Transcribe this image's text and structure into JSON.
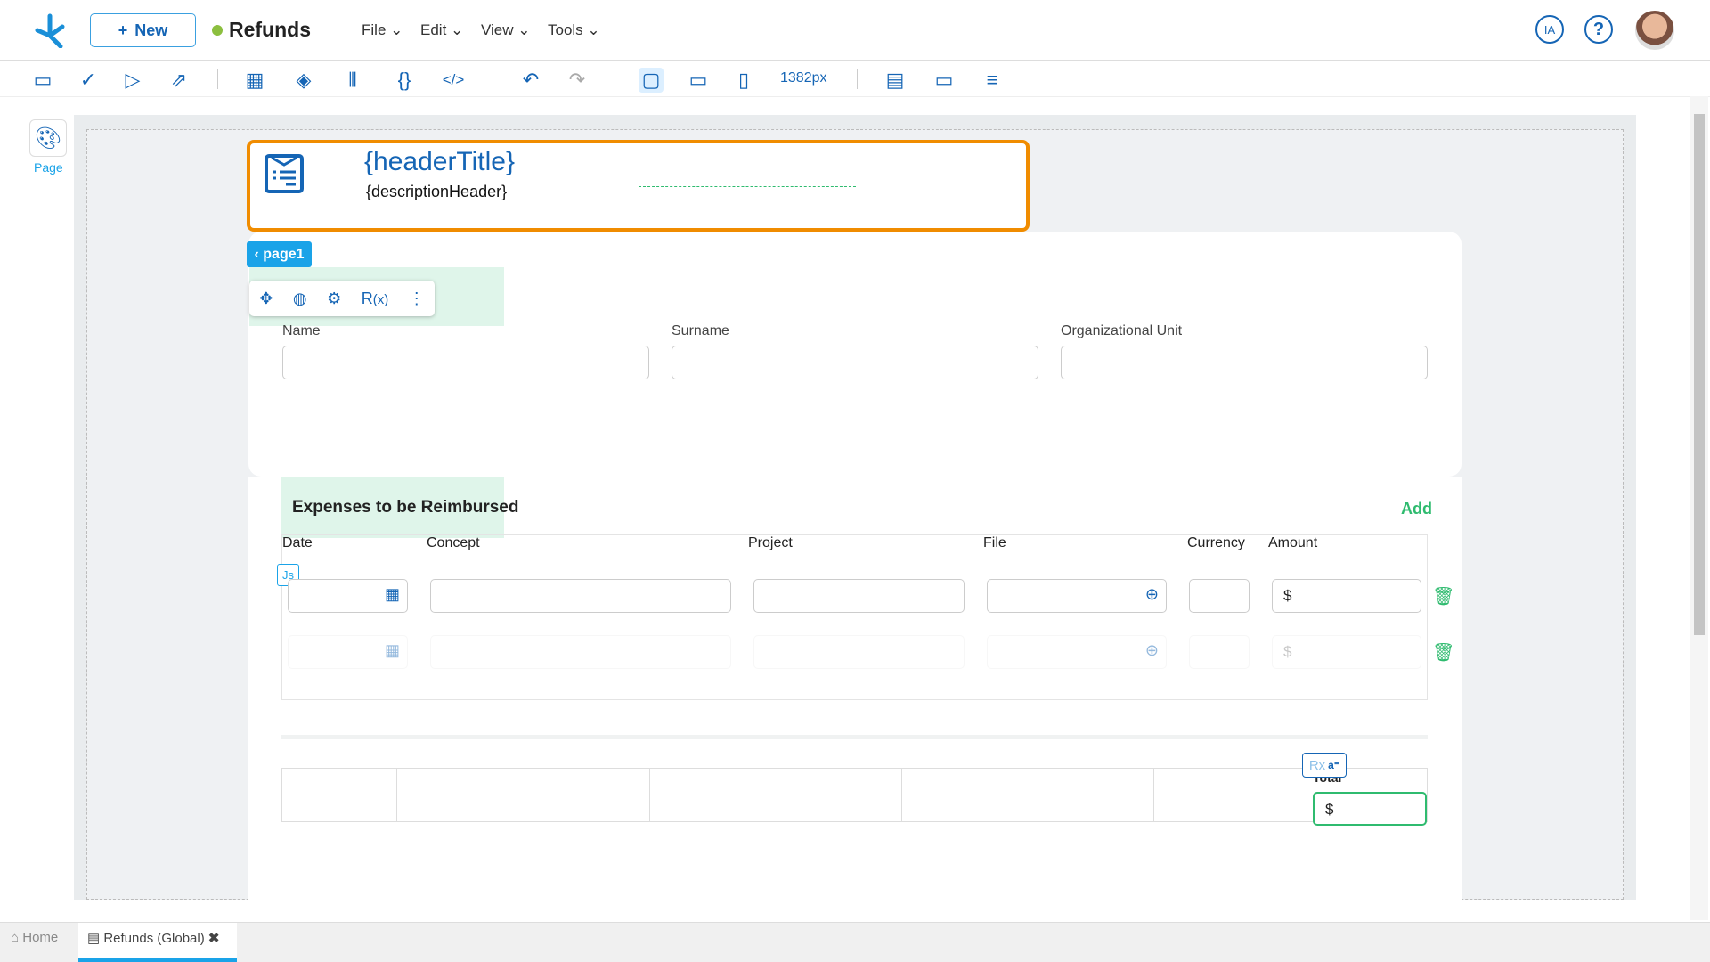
{
  "header": {
    "new_label": "New",
    "app_title": "Refunds",
    "status_color": "#8cbf3f",
    "menus": [
      "File",
      "Edit",
      "View",
      "Tools"
    ],
    "ia_label": "IA"
  },
  "toolbar": {
    "width_label": "1382px",
    "icons": [
      "save-icon",
      "check-icon",
      "play-icon",
      "export-icon",
      "components-icon",
      "layers-icon",
      "data-icon",
      "braces-icon",
      "code-icon",
      "undo-icon",
      "redo-icon",
      "desktop-icon",
      "tablet-icon",
      "mobile-icon",
      "layout-icon",
      "frame-icon",
      "align-icon"
    ]
  },
  "sidebar": {
    "page_label": "Page"
  },
  "form": {
    "header_title": "{headerTitle}",
    "header_description": "{descriptionHeader}",
    "page_tag": "page1",
    "fields": [
      "Name",
      "Surname",
      "Organizational Unit"
    ],
    "expenses": {
      "title": "Expenses to be Reimbursed",
      "add_label": "Add",
      "columns": [
        "Date",
        "Concept",
        "Project",
        "File",
        "Currency",
        "Amount"
      ],
      "currency_symbol": "$",
      "js_badge": "Js"
    },
    "total": {
      "label": "Total",
      "value": "$",
      "rx_label": "Rx"
    }
  },
  "tabs": [
    {
      "label": "Home"
    },
    {
      "label": "Refunds (Global)"
    }
  ],
  "colors": {
    "accent": "#1565b5",
    "selection": "#f08c00",
    "green": "#2fbb6f",
    "tab_active": "#1aa3e8"
  }
}
